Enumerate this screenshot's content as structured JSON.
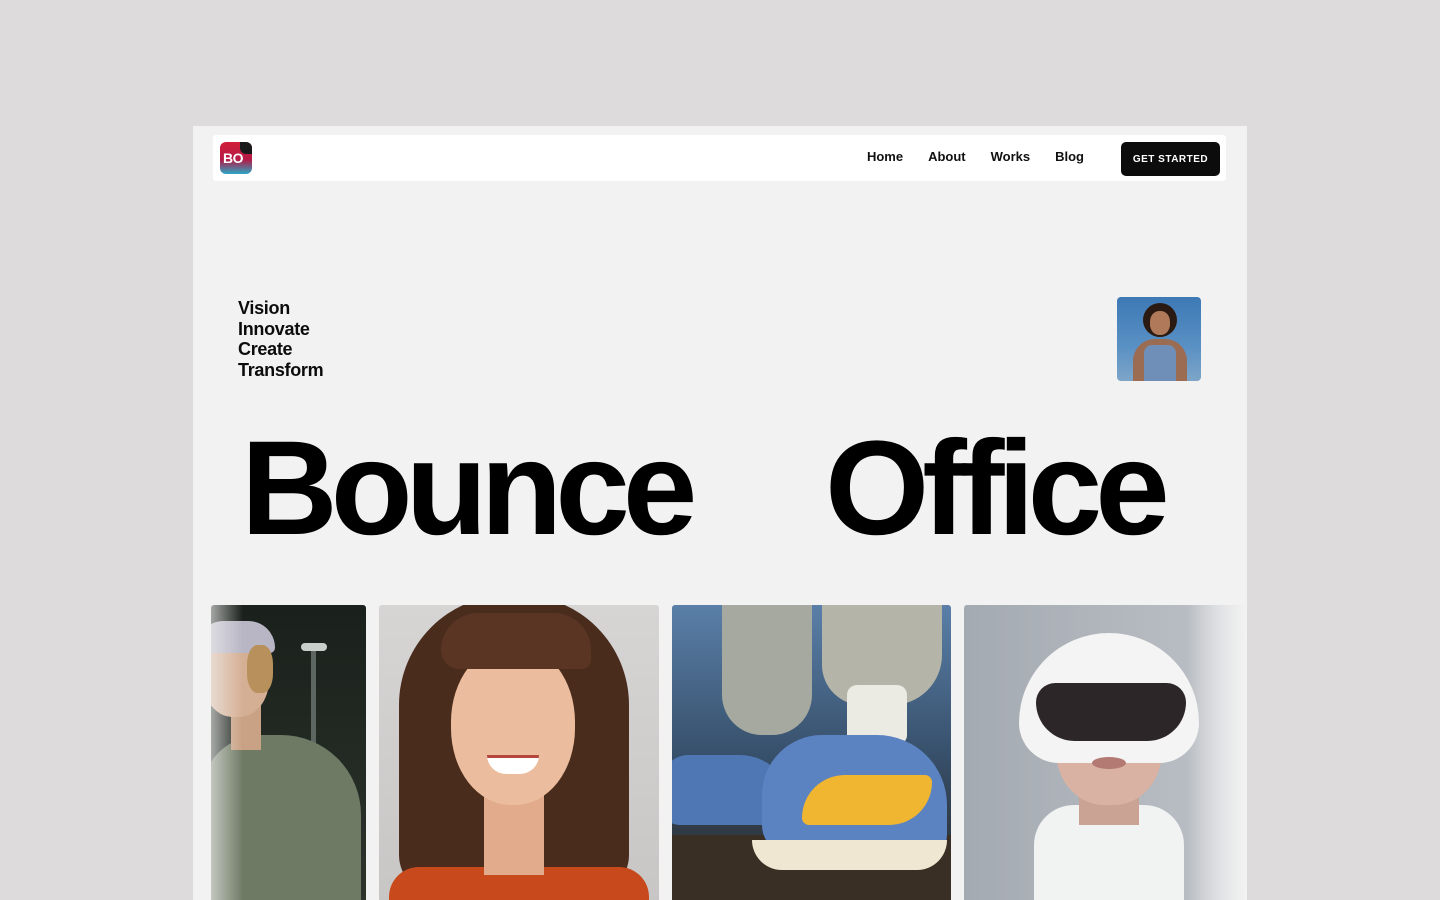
{
  "brand": {
    "logo_text": "BO"
  },
  "nav": {
    "links": [
      "Home",
      "About",
      "Works",
      "Blog"
    ],
    "cta_label": "GET STARTED"
  },
  "tagline": [
    "Vision",
    "Innovate",
    "Create",
    "Transform"
  ],
  "hero": {
    "word_1": "Bounce",
    "word_2": "Office"
  },
  "colors": {
    "page_background": "#dddbdc",
    "frame_background": "#f2f2f2",
    "navbar_background": "#ffffff",
    "text": "#0c0c0c",
    "cta_background": "#0c0c0c",
    "logo_red": "#d21f3a",
    "logo_cyan": "#2aa7c6"
  }
}
